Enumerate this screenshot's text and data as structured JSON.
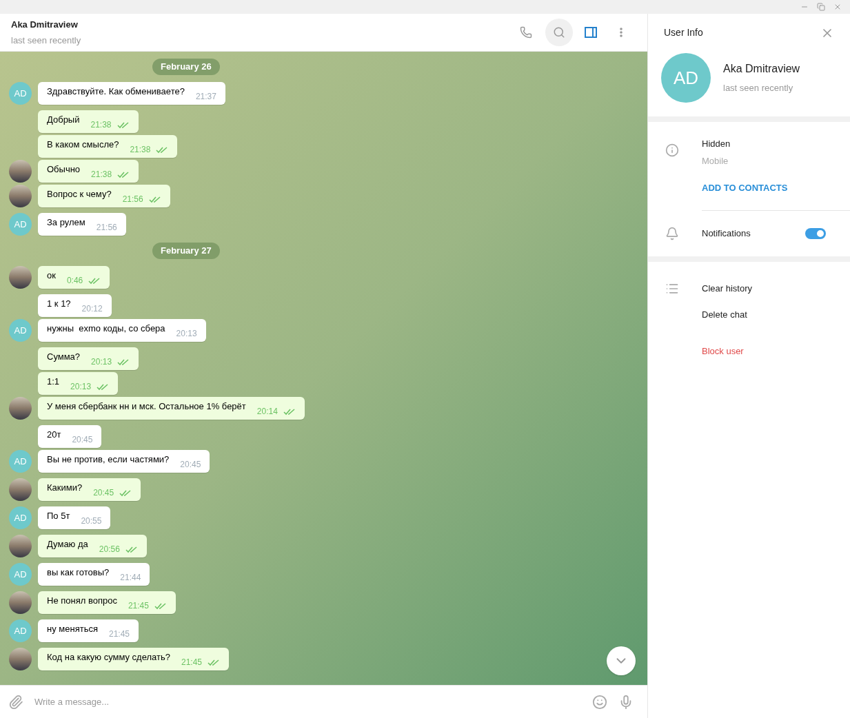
{
  "chat_header": {
    "title": "Aka Dmitraview",
    "status": "last seen recently",
    "search_active": true,
    "panel_active": true
  },
  "messages": [
    {
      "kind": "date",
      "text": "February 26"
    },
    {
      "kind": "message",
      "out": false,
      "avatar": {
        "kind": "initials",
        "text": "AD"
      },
      "text": "Здравствуйте. Как обмениваете?",
      "time": "21:37"
    },
    {
      "kind": "message",
      "out": true,
      "text": "Добрый",
      "time": "21:38",
      "read": true
    },
    {
      "kind": "message",
      "out": true,
      "text": "В каком смысле?",
      "time": "21:38",
      "read": true
    },
    {
      "kind": "message",
      "out": true,
      "avatar": {
        "kind": "photo"
      },
      "text": "Обычно",
      "time": "21:38",
      "read": true
    },
    {
      "kind": "message",
      "out": true,
      "avatar": {
        "kind": "photo"
      },
      "text": "Вопрос к чему?",
      "time": "21:56",
      "read": true
    },
    {
      "kind": "message",
      "out": false,
      "avatar": {
        "kind": "initials",
        "text": "AD"
      },
      "text": "За рулем",
      "time": "21:56"
    },
    {
      "kind": "date",
      "text": "February 27"
    },
    {
      "kind": "message",
      "out": true,
      "avatar": {
        "kind": "photo"
      },
      "text": "ок",
      "time": "0:46",
      "read": true
    },
    {
      "kind": "message",
      "out": false,
      "text": "1 к 1?",
      "time": "20:12"
    },
    {
      "kind": "message",
      "out": false,
      "avatar": {
        "kind": "initials",
        "text": "AD"
      },
      "text": "нужны  exmo коды, со сбера",
      "time": "20:13"
    },
    {
      "kind": "message",
      "out": true,
      "text": "Сумма?",
      "time": "20:13",
      "read": true
    },
    {
      "kind": "message",
      "out": true,
      "text": "1:1",
      "time": "20:13",
      "read": true
    },
    {
      "kind": "message",
      "out": true,
      "avatar": {
        "kind": "photo"
      },
      "text": "У меня сбербанк нн и мск. Остальное 1% берёт",
      "time": "20:14",
      "read": true
    },
    {
      "kind": "message",
      "out": false,
      "text": "20т",
      "time": "20:45"
    },
    {
      "kind": "message",
      "out": false,
      "avatar": {
        "kind": "initials",
        "text": "AD"
      },
      "text": "Вы не против, если частями?",
      "time": "20:45"
    },
    {
      "kind": "message",
      "out": true,
      "avatar": {
        "kind": "photo"
      },
      "text": "Какими?",
      "time": "20:45",
      "read": true
    },
    {
      "kind": "message",
      "out": false,
      "avatar": {
        "kind": "initials",
        "text": "AD"
      },
      "text": "По 5т",
      "time": "20:55"
    },
    {
      "kind": "message",
      "out": true,
      "avatar": {
        "kind": "photo"
      },
      "text": "Думаю да",
      "time": "20:56",
      "read": true
    },
    {
      "kind": "message",
      "out": false,
      "avatar": {
        "kind": "initials",
        "text": "AD"
      },
      "text": "вы как готовы?",
      "time": "21:44"
    },
    {
      "kind": "message",
      "out": true,
      "avatar": {
        "kind": "photo"
      },
      "text": "Не понял вопрос",
      "time": "21:45",
      "read": true
    },
    {
      "kind": "message",
      "out": false,
      "avatar": {
        "kind": "initials",
        "text": "AD"
      },
      "text": "ну меняться",
      "time": "21:45"
    },
    {
      "kind": "message",
      "out": true,
      "avatar": {
        "kind": "photo"
      },
      "text": "Код на какую сумму сделать?",
      "time": "21:45",
      "read": true
    }
  ],
  "composer": {
    "placeholder": "Write a message..."
  },
  "user_info": {
    "title": "User Info",
    "initials": "AD",
    "name": "Aka Dmitraview",
    "status": "last seen recently",
    "info_value": "Hidden",
    "info_label": "Mobile",
    "add_contact": "ADD TO CONTACTS",
    "notifications": {
      "label": "Notifications",
      "on": true
    },
    "actions": [
      {
        "label": "Clear history",
        "danger": false
      },
      {
        "label": "Delete chat",
        "danger": false
      },
      {
        "label": "Block user",
        "danger": true
      }
    ]
  }
}
